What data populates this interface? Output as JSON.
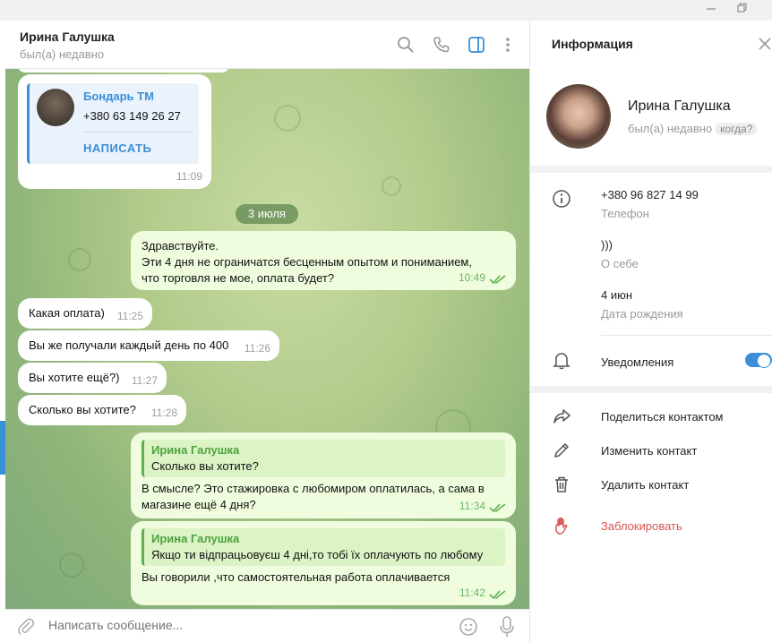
{
  "chat": {
    "title": "Ирина Галушка",
    "status": "был(а) недавно",
    "contact_card": {
      "name": "Бондарь ТМ",
      "phone": "+380 63 149 26 27",
      "action": "НАПИСАТЬ",
      "time": "11:09"
    },
    "date_divider": "3 июля",
    "messages": [
      {
        "dir": "out",
        "lines": [
          "Здравствуйте.",
          "Эти 4 дня не ограничатся бесценным опытом и пониманием,",
          "что торговля не мое, оплата будет?"
        ],
        "time": "10:49"
      },
      {
        "dir": "in",
        "text": "Какая оплата)",
        "time": "11:25"
      },
      {
        "dir": "in",
        "text": "Вы же получали каждый день по 400",
        "time": "11:26"
      },
      {
        "dir": "in",
        "text": "Вы хотите ещё?)",
        "time": "11:27"
      },
      {
        "dir": "in",
        "text": "Сколько вы хотите?",
        "time": "11:28"
      },
      {
        "dir": "out",
        "reply_name": "Ирина Галушка",
        "reply_text": "Сколько вы хотите?",
        "lines": [
          "В смысле? Это стажировка с любомиром оплатилась, а сама в",
          "магазине ещё 4 дня?"
        ],
        "time": "11:34"
      },
      {
        "dir": "out",
        "reply_name": "Ирина Галушка",
        "reply_text": "Якщо ти відпрацьовуєш 4 дні,то тобі їх оплачують по любому",
        "lines": [
          "Вы говорили ,что самостоятельная работа оплачивается"
        ],
        "time": "11:42"
      }
    ],
    "composer_placeholder": "Написать сообщение..."
  },
  "info": {
    "title": "Информация",
    "name": "Ирина Галушка",
    "status": "был(а) недавно",
    "when_pill": "когда?",
    "phone": "+380 96 827 14 99",
    "phone_label": "Телефон",
    "about": ")))",
    "about_label": "О себе",
    "birthday": "4 июн",
    "birthday_label": "Дата рождения",
    "notifications_label": "Уведомления",
    "notifications_on": true,
    "actions": {
      "share": "Поделиться контактом",
      "edit": "Изменить контакт",
      "delete": "Удалить контакт",
      "block": "Заблокировать"
    }
  },
  "colors": {
    "accent": "#3a8fd8",
    "outgoing_bubble": "#effdde",
    "reply_name": "#4ea33f",
    "danger": "#d9534f"
  }
}
